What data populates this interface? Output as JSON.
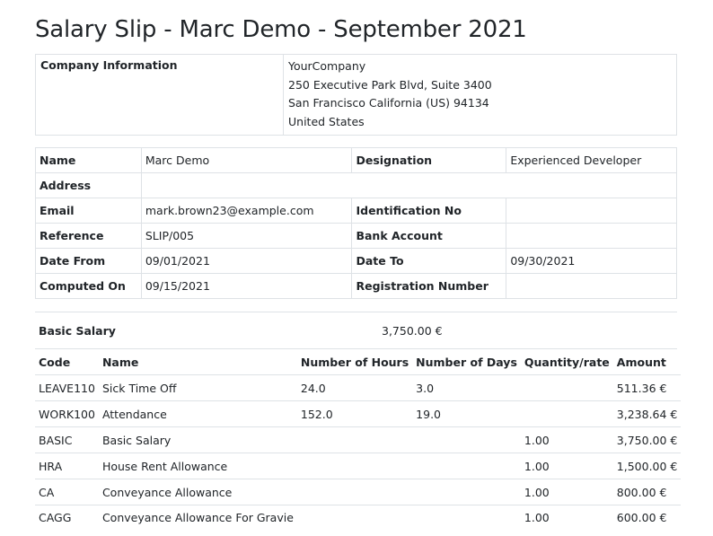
{
  "title": "Salary Slip - Marc Demo - September 2021",
  "company": {
    "label": "Company Information",
    "name": "YourCompany",
    "street": "250 Executive Park Blvd, Suite 3400",
    "city": "San Francisco California (US) 94134",
    "country": "United States"
  },
  "employee": {
    "name_label": "Name",
    "name": "Marc Demo",
    "designation_label": "Designation",
    "designation": "Experienced Developer",
    "address_label": "Address",
    "address": "",
    "email_label": "Email",
    "email": "mark.brown23@example.com",
    "id_label": "Identification No",
    "id": "",
    "reference_label": "Reference",
    "reference": "SLIP/005",
    "bank_label": "Bank Account",
    "bank": "",
    "date_from_label": "Date From",
    "date_from": "09/01/2021",
    "date_to_label": "Date To",
    "date_to": "09/30/2021",
    "computed_label": "Computed On",
    "computed": "09/15/2021",
    "registration_label": "Registration Number",
    "registration": ""
  },
  "basic_salary": {
    "label": "Basic Salary",
    "value": "3,750.00 €"
  },
  "lines": {
    "headers": [
      "Code",
      "Name",
      "Number of Hours",
      "Number of Days",
      "Quantity/rate",
      "Amount"
    ],
    "rows": [
      [
        "LEAVE110",
        "Sick Time Off",
        "24.0",
        "3.0",
        "",
        "511.36 €"
      ],
      [
        "WORK100",
        "Attendance",
        "152.0",
        "19.0",
        "",
        "3,238.64 €"
      ],
      [
        "BASIC",
        "Basic Salary",
        "",
        "",
        "1.00",
        "3,750.00 €"
      ],
      [
        "HRA",
        "House Rent Allowance",
        "",
        "",
        "1.00",
        "1,500.00 €"
      ],
      [
        "CA",
        "Conveyance Allowance",
        "",
        "",
        "1.00",
        "800.00 €"
      ],
      [
        "CAGG",
        "Conveyance Allowance For Gravie",
        "",
        "",
        "1.00",
        "600.00 €"
      ]
    ]
  }
}
